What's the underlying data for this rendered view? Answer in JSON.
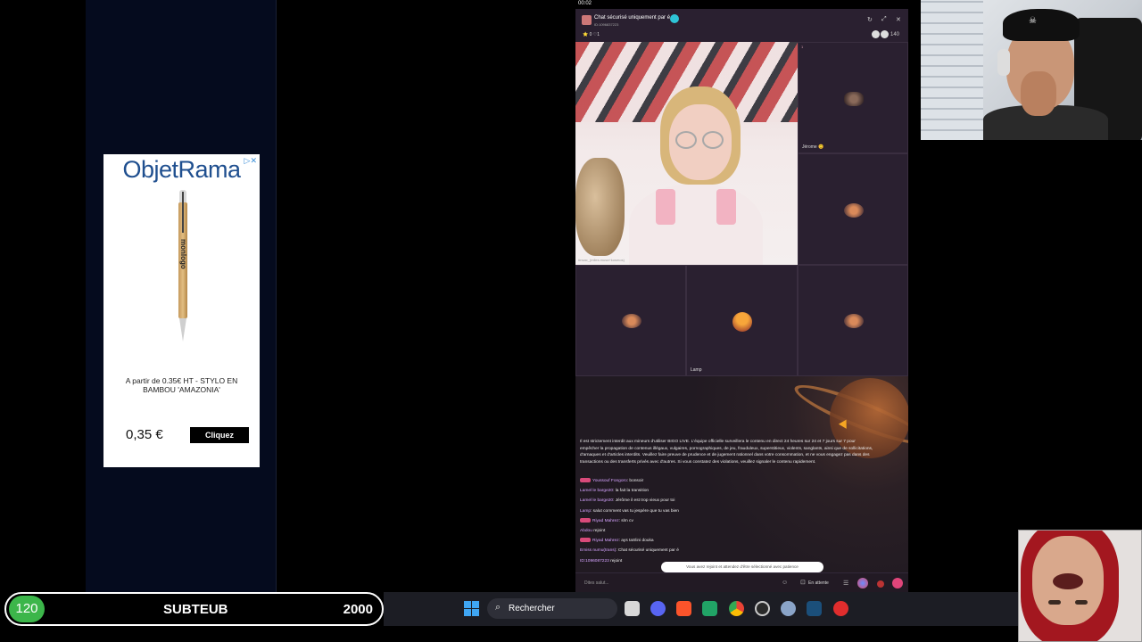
{
  "ad": {
    "brand": "ObjetRama",
    "product_imprint": "monlogo",
    "description": "A partir de 0.35€ HT - STYLO EN BAMBOU 'AMAZONIA'",
    "price": "0,35 €",
    "cta": "Cliquez",
    "close_glyph": "▷✕"
  },
  "app": {
    "clock": "00:02",
    "room_title": "Chat sécurisé uniquement par é",
    "room_sub": "ID:1096837223",
    "fans": "⭐ 0 ♡1",
    "viewers": "140",
    "window_controls": [
      "↻",
      "⤢",
      "✕"
    ],
    "main_label": "#nsac_(mlles.musa+kosmos)",
    "seats": [
      {
        "num": "1",
        "name": "Jérome 😊"
      },
      {
        "num": "2",
        "name": ""
      },
      {
        "num": "3",
        "name": ""
      },
      {
        "num": "4",
        "name": "Lamp"
      },
      {
        "num": "5",
        "name": ""
      }
    ],
    "notice": "Il est strictement interdit aux mineurs d'utiliser BIGO LIVE. L'équipe officielle surveillera le contenu en direct 24 heures sur 24 et 7 jours sur 7 pour empêcher la propagation de contenus illégaux, vulgaires, pornographiques, de jeu, frauduleux, superstitieux, violents, sanglants, ainsi que de sollicitations, d'arnaques et d'articles interdits. Veuillez faire preuve de prudence et de jugement rationnel dans votre consommation, et ne vous engagez pas dans des transactions ou des transferts privés avec d'autres. Si vous constatez des violations, veuillez signaler le contenu rapidement.",
    "messages": [
      {
        "name": "Youssouf Fongoro",
        "text": ": bonsoir",
        "badge": true
      },
      {
        "name": "Lamel le barge20",
        "text": ": la fait la transition",
        "badge": false
      },
      {
        "name": "Lamel le barge20",
        "text": ": Jérôme il est trop vieux pour toi",
        "badge": false
      },
      {
        "name": "Lamp",
        "text": ": salut comment vas tu jespère que tu vas bien",
        "badge": false
      },
      {
        "name": "Riyad Mahrez",
        "text": ": slm cv",
        "badge": true
      },
      {
        "name": "Abdou",
        "text": " rejoint",
        "badge": false
      },
      {
        "name": "Riyad Mahrez",
        "text": ": ays taSlini douka",
        "badge": true
      },
      {
        "name": "Emiss numu(trans)",
        "text": ": Chat sécurisé uniquement par é",
        "badge": false
      },
      {
        "name": "ID:1096087223",
        "text": " rejoint",
        "badge": false
      }
    ],
    "toast": "Vous avez rejoint et attendez d'être sélectionné avec patience",
    "input_placeholder": "Dites salut...",
    "waiting": "En attente"
  },
  "subgoal": {
    "current": "120",
    "label": "SUBTEUB",
    "goal": "2000"
  },
  "taskbar": {
    "search": "Rechercher",
    "search_icon": "search-icon",
    "apps": [
      "file-explorer",
      "discord",
      "brave",
      "spreadsheet",
      "chrome",
      "obs",
      "settings",
      "steam",
      "youtube"
    ]
  },
  "colors": {
    "accent_green": "#3cb64a",
    "app_bg": "#241c27",
    "windows_blue": "#3fa6f3"
  }
}
